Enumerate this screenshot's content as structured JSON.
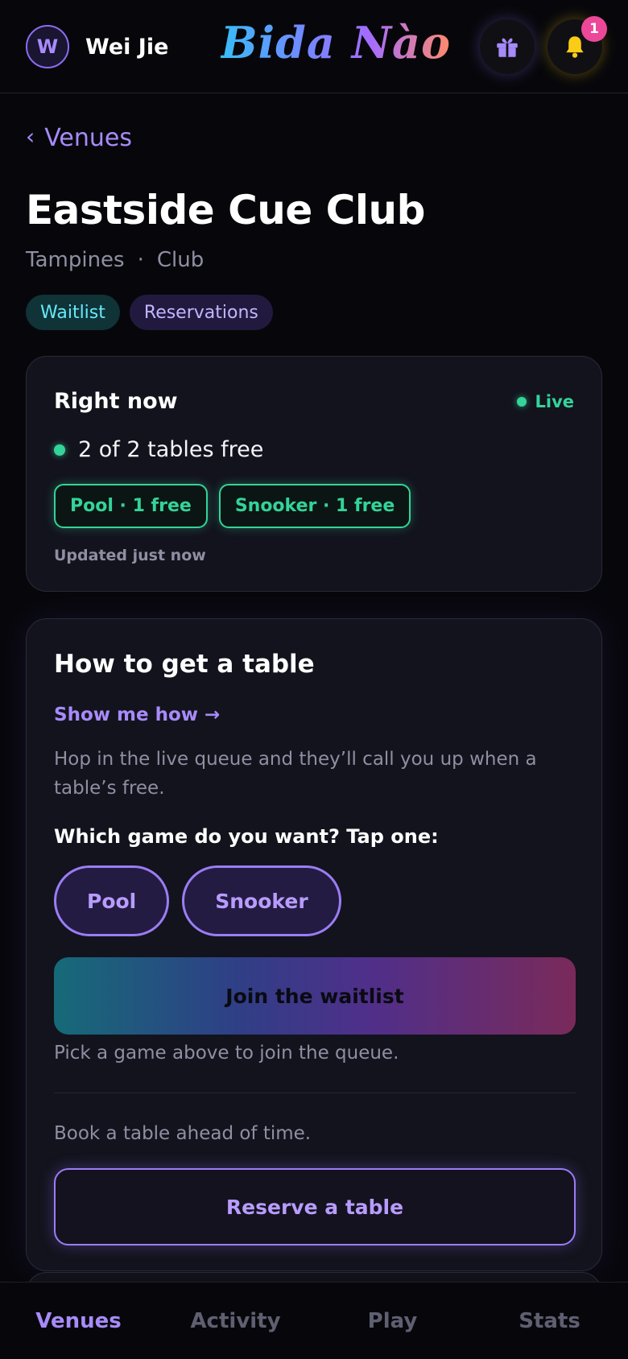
{
  "header": {
    "avatar_initial": "W",
    "user_name": "Wei Jie",
    "brand": "Bida Nào",
    "notification_count": "1",
    "icons": [
      "gift-icon",
      "bell-icon"
    ]
  },
  "back_link": "Venues",
  "venue": {
    "name": "Eastside Cue Club",
    "area": "Tampines",
    "separator": "·",
    "type": "Club",
    "tags": [
      "Waitlist",
      "Reservations"
    ]
  },
  "right_now": {
    "title": "Right now",
    "live_label": "Live",
    "availability": "2 of 2 tables free",
    "chips": [
      "Pool · 1 free",
      "Snooker · 1 free"
    ],
    "updated": "Updated just now"
  },
  "how_to": {
    "title": "How to get a table",
    "show_me_how": "Show me how →",
    "description": "Hop in the live queue and they’ll call you up when a table’s free.",
    "question": "Which game do you want? Tap one:",
    "games": [
      "Pool",
      "Snooker"
    ],
    "join_button": "Join the waitlist",
    "join_hint": "Pick a game above to join the queue.",
    "book_hint": "Book a table ahead of time.",
    "reserve_button": "Reserve a table"
  },
  "nav": {
    "items": [
      "Venues",
      "Activity",
      "Play",
      "Stats"
    ],
    "active": "Venues"
  },
  "colors": {
    "background": "#07070b",
    "card": "#13131d",
    "accent_purple": "#a78bfa",
    "live_green": "#34d399",
    "badge_pink": "#ec4899",
    "bell_yellow": "#facc15"
  }
}
